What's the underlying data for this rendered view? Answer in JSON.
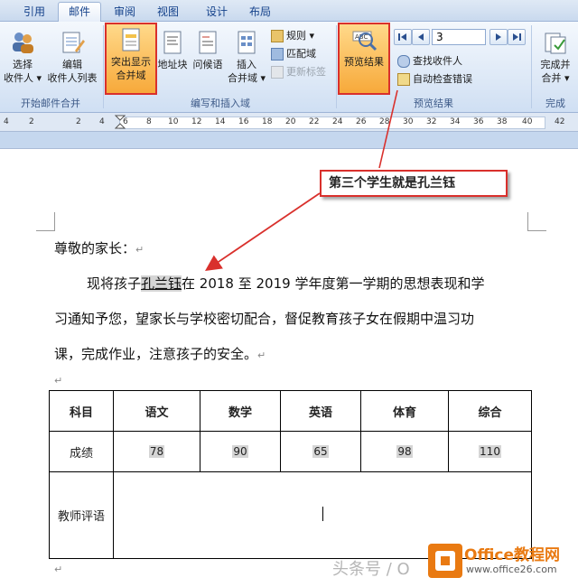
{
  "tabs": [
    "引用",
    "邮件",
    "审阅",
    "视图",
    "设计",
    "布局"
  ],
  "ribbon": {
    "select_recipients": [
      "选择",
      "收件人 ▾"
    ],
    "edit_recipients": [
      "编辑",
      "收件人列表"
    ],
    "group_start": "开始邮件合并",
    "highlight_fields": [
      "突出显示",
      "合并域"
    ],
    "address_block": "地址块",
    "greeting_line": "问候语",
    "insert_field": [
      "插入",
      "合并域 ▾"
    ],
    "rules": "规则 ▾",
    "match_fields": "匹配域",
    "update_labels": "更新标签",
    "group_write": "编写和插入域",
    "preview_results": "预览结果",
    "record_number": "3",
    "find_recipient": "查找收件人",
    "auto_check": "自动检查错误",
    "group_preview": "预览结果",
    "finish_merge": [
      "完成并",
      "合并 ▾"
    ],
    "group_finish": "完成"
  },
  "ruler": {
    "numbers": [
      "4",
      "2",
      "2",
      "4",
      "6",
      "8",
      "10",
      "12",
      "14",
      "16",
      "18",
      "20",
      "22",
      "24",
      "26",
      "28",
      "30",
      "32",
      "34",
      "36",
      "38",
      "40",
      "42"
    ]
  },
  "document": {
    "callout": "第三个学生就是孔兰钰",
    "salutation": "尊敬的家长：",
    "body_prefix": "现将孩子",
    "student_name": "孔兰钰",
    "body_line1_rest": "在 2018 至 2019 学年度第一学期的思想表现和学",
    "body_line2": "习通知予您，望家长与学校密切配合，督促教育孩子女在假期中温习功",
    "body_line3": "课，完成作业，注意孩子的安全。",
    "para_mark": "↵",
    "table": {
      "header": [
        "科目",
        "语文",
        "数学",
        "英语",
        "体育",
        "综合"
      ],
      "scores_label": "成绩",
      "scores": [
        "78",
        "90",
        "65",
        "98",
        "110"
      ],
      "comment_label": "教师评语"
    }
  },
  "watermark": {
    "source_text": "头条号 / O",
    "brand": "Office教程网",
    "url": "www.office26.com"
  },
  "colors": {
    "highlight_red": "#d9302c",
    "accent_orange": "#f7a93a",
    "brand_orange": "#e97a12"
  }
}
